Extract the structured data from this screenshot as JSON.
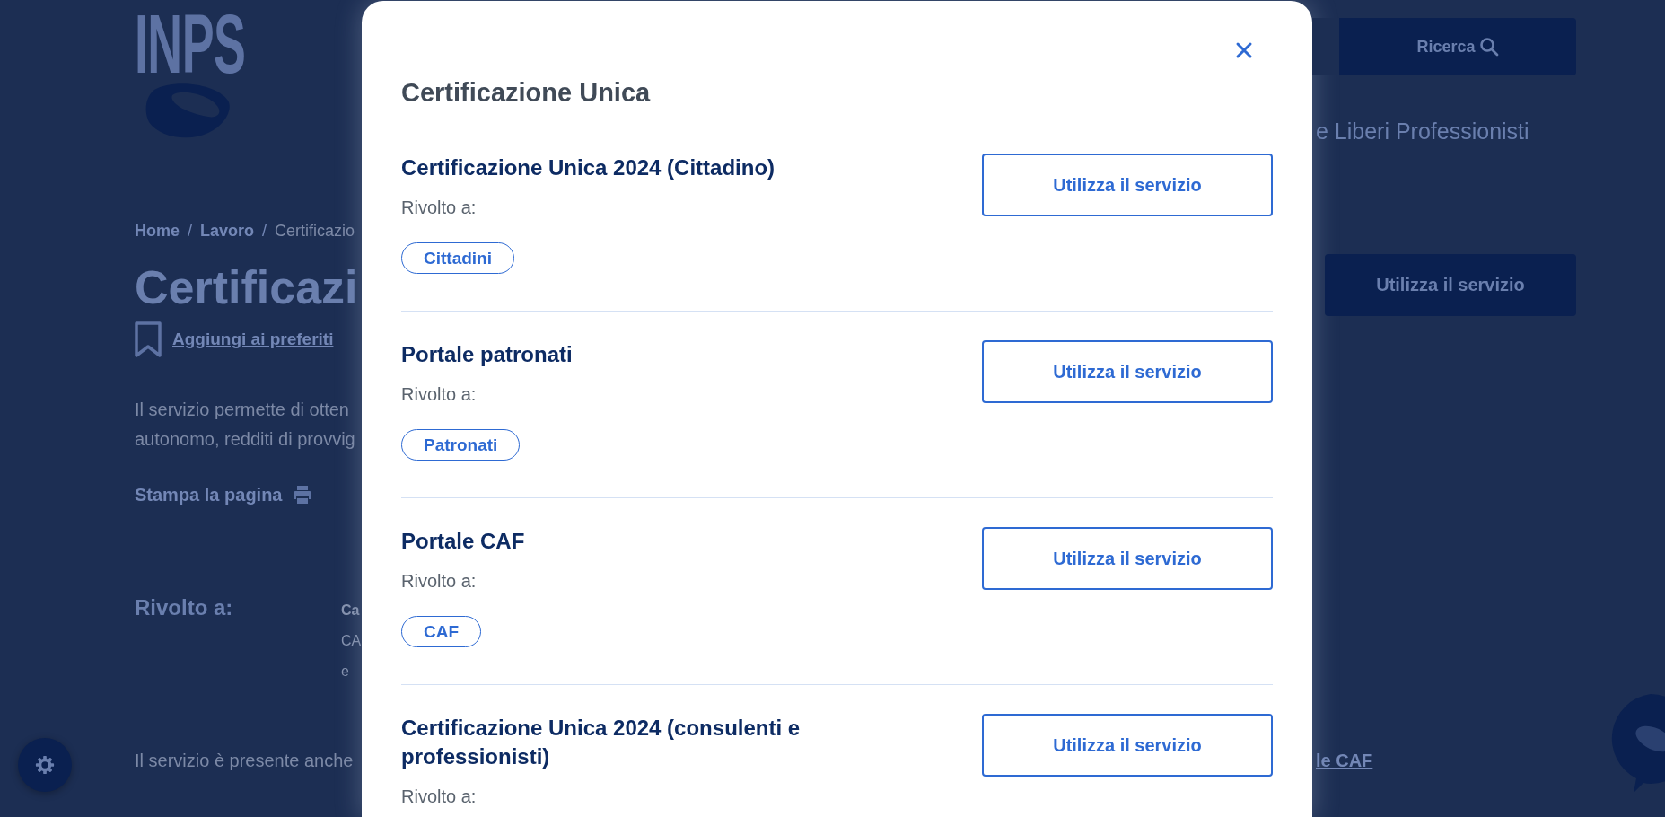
{
  "page": {
    "logo": {
      "wordmark": "INPS"
    },
    "search": {
      "button": "Ricerca"
    },
    "header_text": "e Liberi Professionisti",
    "breadcrumb": [
      {
        "label": "Home",
        "kind": "link"
      },
      {
        "separator": "/",
        "label": "Lavoro",
        "kind": "link"
      },
      {
        "separator": "/",
        "label": "Certificazio",
        "kind": "current"
      }
    ],
    "title": "Certificazi",
    "favorites_link": "Aggiungi ai preferiti",
    "service_button": "Utilizza il servizio",
    "intro_lines": [
      "Il servizio permette di otten",
      "autonomo, redditi di provvig"
    ],
    "print_link": "Stampa la pagina",
    "audience_heading": "Rivolto a:",
    "audience_values": [
      {
        "text": "Ca",
        "kind": "bold"
      },
      {
        "text": "CA",
        "kind": "plain"
      },
      {
        "text": "e",
        "kind": "plain"
      }
    ],
    "footer_text": "Il servizio è presente anche",
    "footer_link": "le CAF"
  },
  "modal": {
    "title": "Certificazione Unica",
    "services": [
      {
        "title": "Certificazione Unica 2024 (Cittadino)",
        "audience_label": "Rivolto a:",
        "tags": [
          "Cittadini"
        ],
        "button": "Utilizza il servizio"
      },
      {
        "title": "Portale patronati",
        "audience_label": "Rivolto a:",
        "tags": [
          "Patronati"
        ],
        "button": "Utilizza il servizio"
      },
      {
        "title": "Portale CAF",
        "audience_label": "Rivolto a:",
        "tags": [
          "CAF"
        ],
        "button": "Utilizza il servizio"
      },
      {
        "title": "Certificazione Unica 2024 (consulenti e professionisti)",
        "audience_label": "Rivolto a:",
        "button": "Utilizza il servizio"
      }
    ]
  }
}
